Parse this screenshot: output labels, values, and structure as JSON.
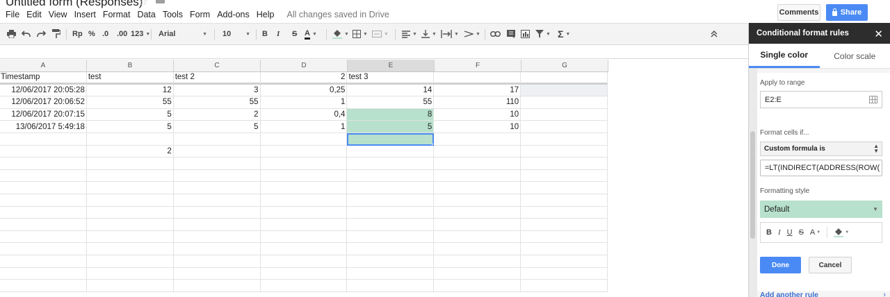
{
  "app": {
    "doc_title": "Untitled form (Responses)",
    "status": "All changes saved in Drive",
    "comments_label": "Comments",
    "share_label": "Share"
  },
  "menu": [
    "File",
    "Edit",
    "View",
    "Insert",
    "Format",
    "Data",
    "Tools",
    "Form",
    "Add-ons",
    "Help"
  ],
  "toolbar": {
    "currency": "Rp",
    "percent": "%",
    "dec_less": ".0",
    "dec_more": ".00",
    "number_format": "123",
    "font": "Arial",
    "font_size": "10",
    "bold": "B",
    "italic": "I",
    "strike": "S",
    "text_color": "A",
    "sum": "Σ"
  },
  "columns": [
    "A",
    "B",
    "C",
    "D",
    "E",
    "F",
    "G"
  ],
  "selected_column": "E",
  "rows": [
    [
      {
        "v": "Timestamp"
      },
      {
        "v": "test"
      },
      {
        "v": "test 2"
      },
      {
        "v": "2",
        "num": true
      },
      {
        "v": "test 3"
      },
      {
        "v": ""
      },
      {
        "v": ""
      }
    ],
    [
      {
        "v": "12/06/2017 20:05:28",
        "num": true
      },
      {
        "v": "12",
        "num": true
      },
      {
        "v": "3",
        "num": true
      },
      {
        "v": "0,25",
        "num": true
      },
      {
        "v": "14",
        "num": true
      },
      {
        "v": "17",
        "num": true
      },
      {
        "v": "",
        "gray": true
      }
    ],
    [
      {
        "v": "12/06/2017 20:06:52",
        "num": true
      },
      {
        "v": "55",
        "num": true
      },
      {
        "v": "55",
        "num": true
      },
      {
        "v": "1",
        "num": true
      },
      {
        "v": "55",
        "num": true
      },
      {
        "v": "110",
        "num": true
      },
      {
        "v": ""
      }
    ],
    [
      {
        "v": "12/06/2017 20:07:15",
        "num": true
      },
      {
        "v": "5",
        "num": true
      },
      {
        "v": "2",
        "num": true
      },
      {
        "v": "0,4",
        "num": true
      },
      {
        "v": "8",
        "num": true,
        "green": true
      },
      {
        "v": "10",
        "num": true
      },
      {
        "v": ""
      }
    ],
    [
      {
        "v": "13/06/2017 5:49:18",
        "num": true
      },
      {
        "v": "5",
        "num": true
      },
      {
        "v": "5",
        "num": true
      },
      {
        "v": "1",
        "num": true
      },
      {
        "v": "5",
        "num": true,
        "green": true
      },
      {
        "v": "10",
        "num": true
      },
      {
        "v": ""
      }
    ],
    [
      {
        "v": ""
      },
      {
        "v": ""
      },
      {
        "v": ""
      },
      {
        "v": ""
      },
      {
        "v": "",
        "green": true,
        "selected": true
      },
      {
        "v": ""
      },
      {
        "v": ""
      }
    ],
    [
      {
        "v": ""
      },
      {
        "v": "2",
        "num": true
      },
      {
        "v": ""
      },
      {
        "v": ""
      },
      {
        "v": ""
      },
      {
        "v": ""
      },
      {
        "v": ""
      }
    ],
    [],
    [],
    [],
    [],
    [],
    [],
    [],
    [],
    [],
    [],
    []
  ],
  "panel": {
    "title": "Conditional format rules",
    "tabs": [
      "Single color",
      "Color scale"
    ],
    "active_tab": "Single color",
    "apply_label": "Apply to range",
    "range_value": "E2:E",
    "format_if_label": "Format cells if...",
    "condition": "Custom formula is",
    "formula": "=LT(INDIRECT(ADDRESS(ROW(",
    "style_label": "Formatting style",
    "style_value": "Default",
    "done_label": "Done",
    "cancel_label": "Cancel",
    "add_rule_label": "Add another rule"
  },
  "colors": {
    "accent": "#4a8af4",
    "highlight": "#b7e1cd",
    "panel_header": "#2d2d2d"
  }
}
